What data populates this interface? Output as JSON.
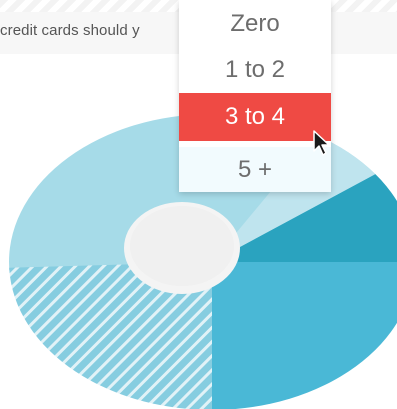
{
  "question": {
    "text": "credit cards should y"
  },
  "dropdown": {
    "options": [
      {
        "label": "Zero"
      },
      {
        "label": "1 to 2"
      },
      {
        "label": "3 to 4"
      },
      {
        "label": "5 +"
      }
    ],
    "selected_index": 2,
    "selected_color": "#ef4a44"
  },
  "colors": {
    "chart_light": "#8fd0e0",
    "chart_mid": "#4ab8d6",
    "chart_dark": "#2aa3bf",
    "chart_top": "#a6dbe8"
  },
  "cursor": {
    "icon": "arrow-pointer-icon"
  }
}
